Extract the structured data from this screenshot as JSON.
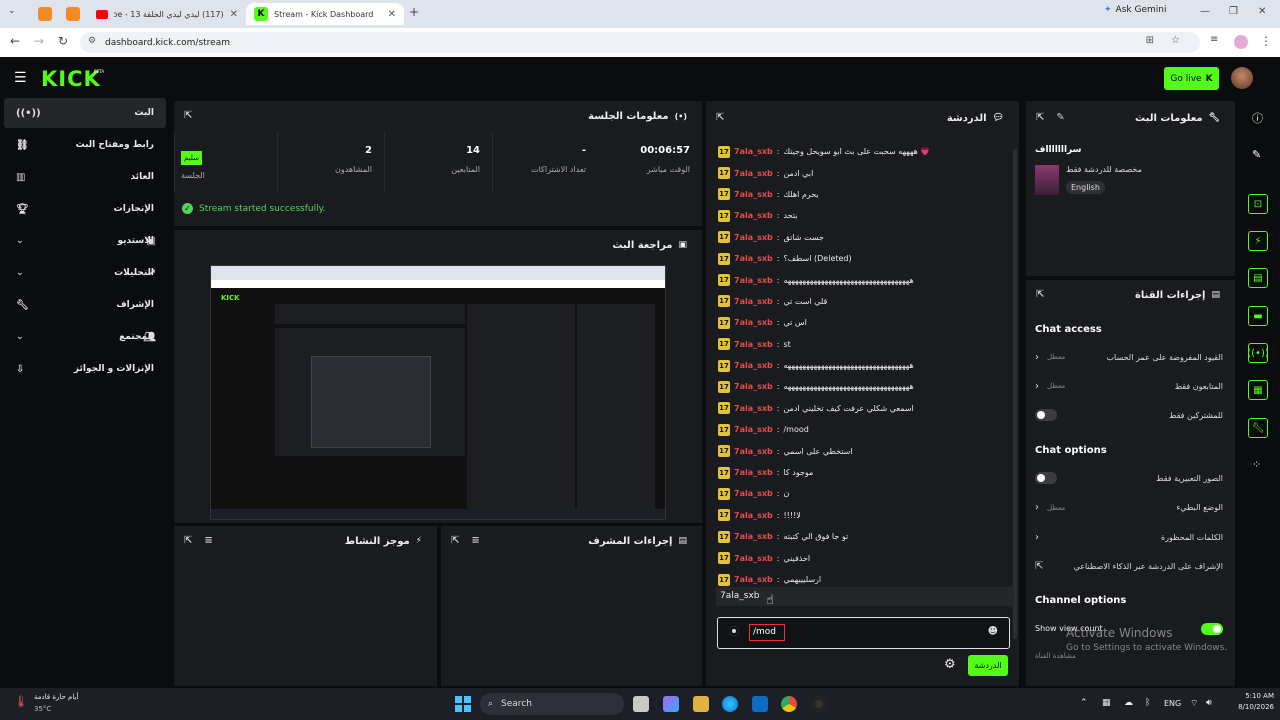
{
  "browser": {
    "tabs": [
      {
        "title": "",
        "active": false
      },
      {
        "title": "",
        "active": false
      },
      {
        "title": "(117) ليدي ليدي الحلقة 13 - YouTube",
        "active": false
      },
      {
        "title": "Stream - Kick Dashboard",
        "active": true
      }
    ],
    "new_tab": "+",
    "ask_gemini": "Ask Gemini",
    "url": "dashboard.kick.com/stream"
  },
  "header": {
    "logo": "KICK",
    "beta": "BETA",
    "go_live": "Go live"
  },
  "sidebar": {
    "items": [
      {
        "label": "البث",
        "icon": "broadcast-icon",
        "active": true,
        "expandable": false
      },
      {
        "label": "رابط ومفتاح البث",
        "icon": "link-icon",
        "active": false,
        "expandable": false
      },
      {
        "label": "العائد",
        "icon": "chart-icon",
        "active": false,
        "expandable": false
      },
      {
        "label": "الإنجازات",
        "icon": "trophy-icon",
        "active": false,
        "expandable": false
      },
      {
        "label": "الاستديو",
        "icon": "studio-icon",
        "active": false,
        "expandable": true
      },
      {
        "label": "التحليلات",
        "icon": "analytics-icon",
        "active": false,
        "expandable": true
      },
      {
        "label": "الإشراف",
        "icon": "wrench-icon",
        "active": false,
        "expandable": false
      },
      {
        "label": "المجتمع",
        "icon": "community-icon",
        "active": false,
        "expandable": true
      },
      {
        "label": "الإنزالات و الجوائز",
        "icon": "drops-icon",
        "active": false,
        "expandable": false
      }
    ]
  },
  "session": {
    "title": "معلومات الجلسة",
    "stats": [
      {
        "value": "00:06:57",
        "label": "الوقت مباشر"
      },
      {
        "value": "-",
        "label": "تعداد الاشتراكات"
      },
      {
        "value": "14",
        "label": "المتابعين"
      },
      {
        "value": "2",
        "label": "المشاهدون"
      },
      {
        "value": "سليم",
        "label": "الجلسة"
      }
    ],
    "status": "Stream started successfully."
  },
  "preview": {
    "title": "مراجعة البث"
  },
  "activity": {
    "title": "موجز النشاط"
  },
  "modactions": {
    "title": "إجراءات المشرف"
  },
  "chat": {
    "title": "الدردشة",
    "messages": [
      {
        "badge": "17",
        "user": "7ala_sxb",
        "text": "ههههه سحبت على بث ابو سويحل وجيتك 💗"
      },
      {
        "badge": "17",
        "user": "7ala_sxb",
        "text": "ابي ادمن"
      },
      {
        "badge": "17",
        "user": "7ala_sxb",
        "text": "يحرم اهلك"
      },
      {
        "badge": "17",
        "user": "7ala_sxb",
        "text": "بتحد"
      },
      {
        "badge": "17",
        "user": "7ala_sxb",
        "text": "جست شاتق"
      },
      {
        "badge": "17",
        "user": "7ala_sxb",
        "text": "اسطف؟ (Deleted)"
      },
      {
        "badge": "17",
        "user": "7ala_sxb",
        "text": "ههههههههههههههههههههههههههههههههههه"
      },
      {
        "badge": "17",
        "user": "7ala_sxb",
        "text": "قلي است تي"
      },
      {
        "badge": "17",
        "user": "7ala_sxb",
        "text": "اس تي"
      },
      {
        "badge": "17",
        "user": "7ala_sxb",
        "text": "st"
      },
      {
        "badge": "17",
        "user": "7ala_sxb",
        "text": "ههههههههههههههههههههههههههههههههههه"
      },
      {
        "badge": "17",
        "user": "7ala_sxb",
        "text": "ههههههههههههههههههههههههههههههههههه"
      },
      {
        "badge": "17",
        "user": "7ala_sxb",
        "text": "اسمعي شكلي عرفت كيف تخليني ادمن"
      },
      {
        "badge": "17",
        "user": "7ala_sxb",
        "text": "/mood"
      },
      {
        "badge": "17",
        "user": "7ala_sxb",
        "text": "استخطي على اسمي"
      },
      {
        "badge": "17",
        "user": "7ala_sxb",
        "text": "موجود كا"
      },
      {
        "badge": "17",
        "user": "7ala_sxb",
        "text": "ن"
      },
      {
        "badge": "17",
        "user": "7ala_sxb",
        "text": "!!!!لا"
      },
      {
        "badge": "17",
        "user": "7ala_sxb",
        "text": "تو جا فوق الي كتبته"
      },
      {
        "badge": "17",
        "user": "7ala_sxb",
        "text": "احذفيني"
      },
      {
        "badge": "17",
        "user": "7ala_sxb",
        "text": "ارسليييهمي"
      }
    ],
    "suggestion": "7ala_sxb",
    "input_value": "/mod",
    "send_label": "الدردشة"
  },
  "stream_info": {
    "title": "معلومات البث",
    "stream_title": "سراااااااف",
    "category": "مخصصة للدردشة فقط",
    "language": "English"
  },
  "channel_actions": {
    "title": "إجراءات القناة",
    "chat_access_title": "Chat access",
    "chat_access": [
      {
        "label": "القيود المفروضة على عمر الحساب",
        "state": "معطل",
        "type": "link"
      },
      {
        "label": "المتابعون فقط",
        "state": "معطل",
        "type": "link"
      },
      {
        "label": "للمشتركين فقط",
        "state": "",
        "type": "toggle",
        "on": false
      }
    ],
    "chat_options_title": "Chat options",
    "chat_options": [
      {
        "label": "الصور التعبيرية فقط",
        "state": "",
        "type": "toggle",
        "on": false
      },
      {
        "label": "الوضع البطيء",
        "state": "معطل",
        "type": "link"
      },
      {
        "label": "الكلمات المحظورة",
        "state": "",
        "type": "link"
      },
      {
        "label": "الإشراف على الدردشة عبر الذكاء الاصطناعي",
        "state": "",
        "type": "external"
      }
    ],
    "channel_options_title": "Channel options",
    "show_view_count": "Show view count",
    "show_view_count_on": true,
    "channel_sub": "مشاهدة القناة"
  },
  "watermark": {
    "line1": "Activate Windows",
    "line2": "Go to Settings to activate Windows."
  },
  "taskbar": {
    "weather_text": "أيام حارة قادمة",
    "temp": "35°C",
    "search": "Search",
    "lang": "ENG",
    "time": "5:10 AM",
    "date": "8/10/2026"
  }
}
